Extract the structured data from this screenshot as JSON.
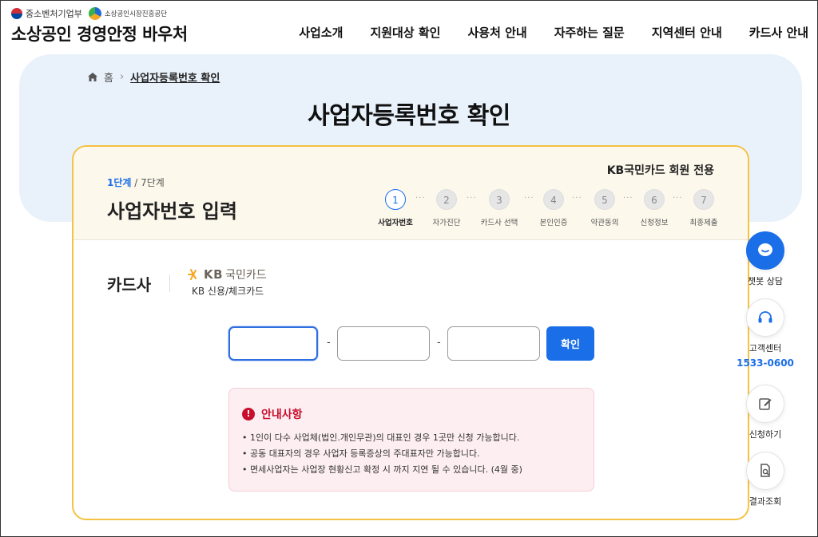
{
  "header": {
    "org_logo": "중소벤처기업부",
    "agency_logo": "소상공인시장진흥공단",
    "site_title": "소상공인 경영안정 바우처",
    "nav": [
      "사업소개",
      "지원대상 확인",
      "사용처 안내",
      "자주하는 질문",
      "지역센터 안내",
      "카드사 안내"
    ]
  },
  "breadcrumb": {
    "home": "홈",
    "current": "사업자등록번호 확인"
  },
  "page_title": "사업자등록번호 확인",
  "card": {
    "step_current": "1단계",
    "step_total": " / 7단계",
    "title": "사업자번호 입력",
    "member_only": "KB국민카드 회원 전용",
    "steps": [
      {
        "num": "1",
        "label": "사업자번호",
        "active": true
      },
      {
        "num": "2",
        "label": "자가진단"
      },
      {
        "num": "3",
        "label": "카드사 선택"
      },
      {
        "num": "4",
        "label": "본인인증"
      },
      {
        "num": "5",
        "label": "약관동의"
      },
      {
        "num": "6",
        "label": "신청정보"
      },
      {
        "num": "7",
        "label": "최종제출"
      }
    ],
    "step_dots": "···",
    "card_company_label": "카드사",
    "kb_logo_text": "KB",
    "kb_logo_name": "국민카드",
    "kb_sub": "KB 신용/체크카드",
    "inputs": {
      "part1": "",
      "part2": "",
      "part3": ""
    },
    "dash": "-",
    "confirm_label": "확인"
  },
  "notice": {
    "icon": "!",
    "title": "안내사항",
    "items": [
      "• 1인이 다수 사업체(법인.개인무관)의 대표인 경우 1곳만 신청 가능합니다.",
      "• 공동 대표자의 경우 사업자 등록증상의 주대표자만 가능합니다.",
      "• 면세사업자는 사업장 현황신고 확정 시 까지 지연 될 수 있습니다. (4월 중)"
    ]
  },
  "quick_menu": {
    "chatbot": "챗봇 상담",
    "customer_center": "고객센터",
    "phone": "1533-0600",
    "apply": "신청하기",
    "result": "결과조회"
  },
  "colors": {
    "accent": "#1a6ee8",
    "card_border": "#f5c242",
    "notice_red": "#c8102e"
  }
}
